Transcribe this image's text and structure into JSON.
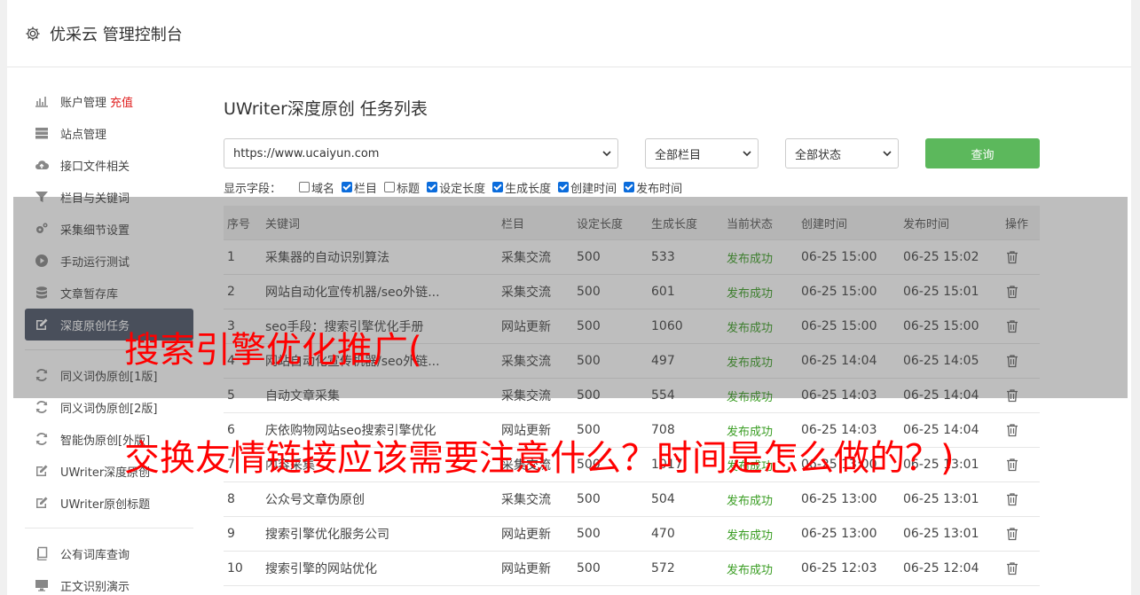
{
  "header": {
    "title": "优采云 管理控制台"
  },
  "sidebar": {
    "items": [
      {
        "label": "账户管理",
        "badge": "充值",
        "icon": "bar-chart-icon"
      },
      {
        "label": "站点管理",
        "icon": "server-icon"
      },
      {
        "label": "接口文件相关",
        "icon": "cloud-upload-icon"
      },
      {
        "label": "栏目与关键词",
        "icon": "filter-icon"
      },
      {
        "label": "采集细节设置",
        "icon": "gears-icon"
      },
      {
        "label": "手动运行测试",
        "icon": "play-icon"
      },
      {
        "label": "文章暂存库",
        "icon": "database-icon"
      },
      {
        "label": "深度原创任务",
        "icon": "edit-icon"
      }
    ],
    "items2": [
      {
        "label": "同义词伪原创[1版]",
        "icon": "refresh-icon"
      },
      {
        "label": "同义词伪原创[2版]",
        "icon": "refresh-icon"
      },
      {
        "label": "智能伪原创[外版]",
        "icon": "refresh-icon"
      },
      {
        "label": "UWriter深度原创",
        "icon": "edit-icon"
      },
      {
        "label": "UWriter原创标题",
        "icon": "edit-icon"
      }
    ],
    "items3": [
      {
        "label": "公有词库查询",
        "icon": "book-icon"
      },
      {
        "label": "正文识别演示",
        "icon": "desktop-icon"
      }
    ]
  },
  "main": {
    "title": "UWriter深度原创 任务列表",
    "filters": {
      "site": "https://www.ucaiyun.com",
      "column": "全部栏目",
      "status": "全部状态",
      "query_label": "查询"
    },
    "fields_label": "显示字段：",
    "fields": [
      {
        "label": "域名",
        "checked": false
      },
      {
        "label": "栏目",
        "checked": true
      },
      {
        "label": "标题",
        "checked": false
      },
      {
        "label": "设定长度",
        "checked": true
      },
      {
        "label": "生成长度",
        "checked": true
      },
      {
        "label": "创建时间",
        "checked": true
      },
      {
        "label": "发布时间",
        "checked": true
      }
    ],
    "table": {
      "headers": [
        "序号",
        "关键词",
        "栏目",
        "设定长度",
        "生成长度",
        "当前状态",
        "创建时间",
        "发布时间",
        "操作"
      ],
      "rows": [
        [
          "1",
          "采集器的自动识别算法",
          "采集交流",
          "500",
          "533",
          "发布成功",
          "06-25 15:00",
          "06-25 15:02"
        ],
        [
          "2",
          "网站自动化宣传机器/seo外链...",
          "采集交流",
          "500",
          "601",
          "发布成功",
          "06-25 15:00",
          "06-25 15:01"
        ],
        [
          "3",
          "seo手段：搜索引擎优化手册",
          "网站更新",
          "500",
          "1060",
          "发布成功",
          "06-25 15:00",
          "06-25 15:00"
        ],
        [
          "4",
          "网站自动化宣传机器/seo外链...",
          "采集交流",
          "500",
          "497",
          "发布成功",
          "06-25 14:04",
          "06-25 14:05"
        ],
        [
          "5",
          "自动文章采集",
          "采集交流",
          "500",
          "554",
          "发布成功",
          "06-25 14:03",
          "06-25 14:04"
        ],
        [
          "6",
          "庆依购物网站seo搜索引擎优化",
          "网站更新",
          "500",
          "708",
          "发布成功",
          "06-25 14:03",
          "06-25 14:04"
        ],
        [
          "7",
          "内容采集",
          "采集交流",
          "500",
          "1017",
          "发布成功",
          "06-25 13:00",
          "06-25 13:01"
        ],
        [
          "8",
          "公众号文章伪原创",
          "采集交流",
          "500",
          "504",
          "发布成功",
          "06-25 13:00",
          "06-25 13:01"
        ],
        [
          "9",
          "搜索引擎优化服务公司",
          "网站更新",
          "500",
          "470",
          "发布成功",
          "06-25 13:00",
          "06-25 13:01"
        ],
        [
          "10",
          "搜索引擎的网站优化",
          "网站更新",
          "500",
          "572",
          "发布成功",
          "06-25 12:03",
          "06-25 12:04"
        ]
      ]
    }
  },
  "overlay": {
    "line1": "搜索引擎优化推广(",
    "line2": "交换友情链接应该需要注意什么？时间是怎么做的？)"
  },
  "colors": {
    "accent": "#5cb85c",
    "active_nav": "#4c5567",
    "status_ok": "#3a9d23",
    "badge": "#e02020",
    "overlay_text": "#ff0000"
  }
}
